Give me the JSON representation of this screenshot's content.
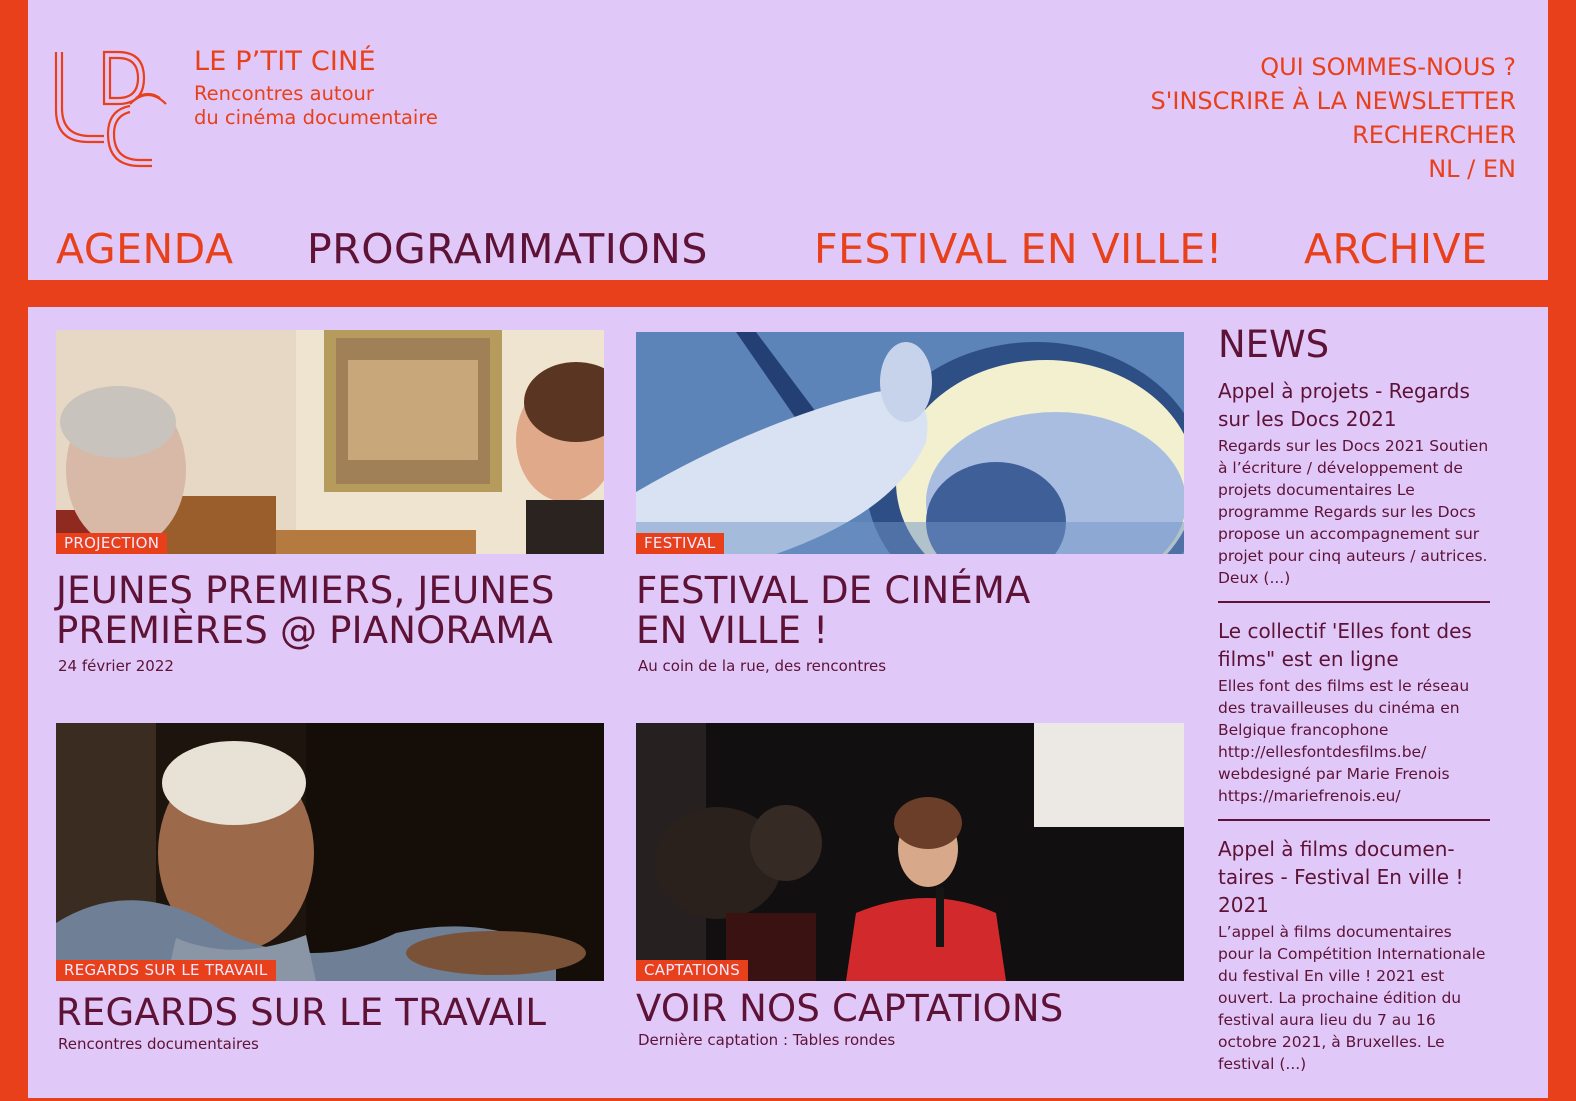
{
  "colors": {
    "accent": "#e8401a",
    "background": "#e0c9f8",
    "text_dark": "#5e1236"
  },
  "brand": {
    "logo_icon": "lpc-monogram-logo",
    "name": "LE P’TIT CINÉ",
    "tagline_1": "Rencontres autour",
    "tagline_2": "du cinéma documentaire"
  },
  "utility_nav": {
    "about": "QUI SOMMES-NOUS ?",
    "newsletter": "S'INSCRIRE À LA NEWSLETTER",
    "search": "RECHERCHER",
    "languages": "NL / EN"
  },
  "main_nav": {
    "agenda": "AGENDA",
    "programmations": "PROGRAMMATIONS",
    "festival": "FESTIVAL EN VILLE!",
    "archive": "ARCHIVE"
  },
  "cards": [
    {
      "tag": "PROJECTION",
      "title": "JEUNES PREMIERS, JEUNES PREMIÈRES @ PIANORAMA",
      "subtitle": "24 février 2022"
    },
    {
      "tag": "FESTIVAL",
      "title": "FESTIVAL DE CINÉMA EN VILLE !",
      "subtitle": "Au coin de la rue, des rencontres"
    },
    {
      "tag": "REGARDS SUR LE TRAVAIL",
      "title": "REGARDS SUR LE TRAVAIL",
      "subtitle": "Rencontres documentaires"
    },
    {
      "tag": "CAPTATIONS",
      "title": "VOIR NOS CAPTATIONS",
      "subtitle": "Dernière captation : Tables rondes"
    }
  ],
  "news": {
    "heading": "NEWS",
    "items": [
      {
        "title": "Appel à projets - Regards sur les Docs 2021",
        "body": "Regards sur les Docs 2021 Soutien à l’écriture / développement de projets documentaires Le programme Regards sur les Docs propose un accompagnement sur projet pour cinq auteurs / autrices. Deux (...)"
      },
      {
        "title": "Le collectif 'Elles font des films\" est en ligne",
        "body": "Elles font des films est le réseau des travailleuses du cinéma en Belgique francophone http://ellesfontdesfilms.be/ webdesigné par Marie Frenois https://mariefrenois.eu/"
      },
      {
        "title": "Appel à films documen­taires - Festival En ville ! 2021",
        "body": "L’appel à films documentaires pour la Compétition Internatio­nale du festival En ville ! 2021 est ouvert. La prochaine édition du festival aura lieu du 7 au 16 octobre 2021, à Bruxelles. Le festival (...)"
      }
    ]
  }
}
